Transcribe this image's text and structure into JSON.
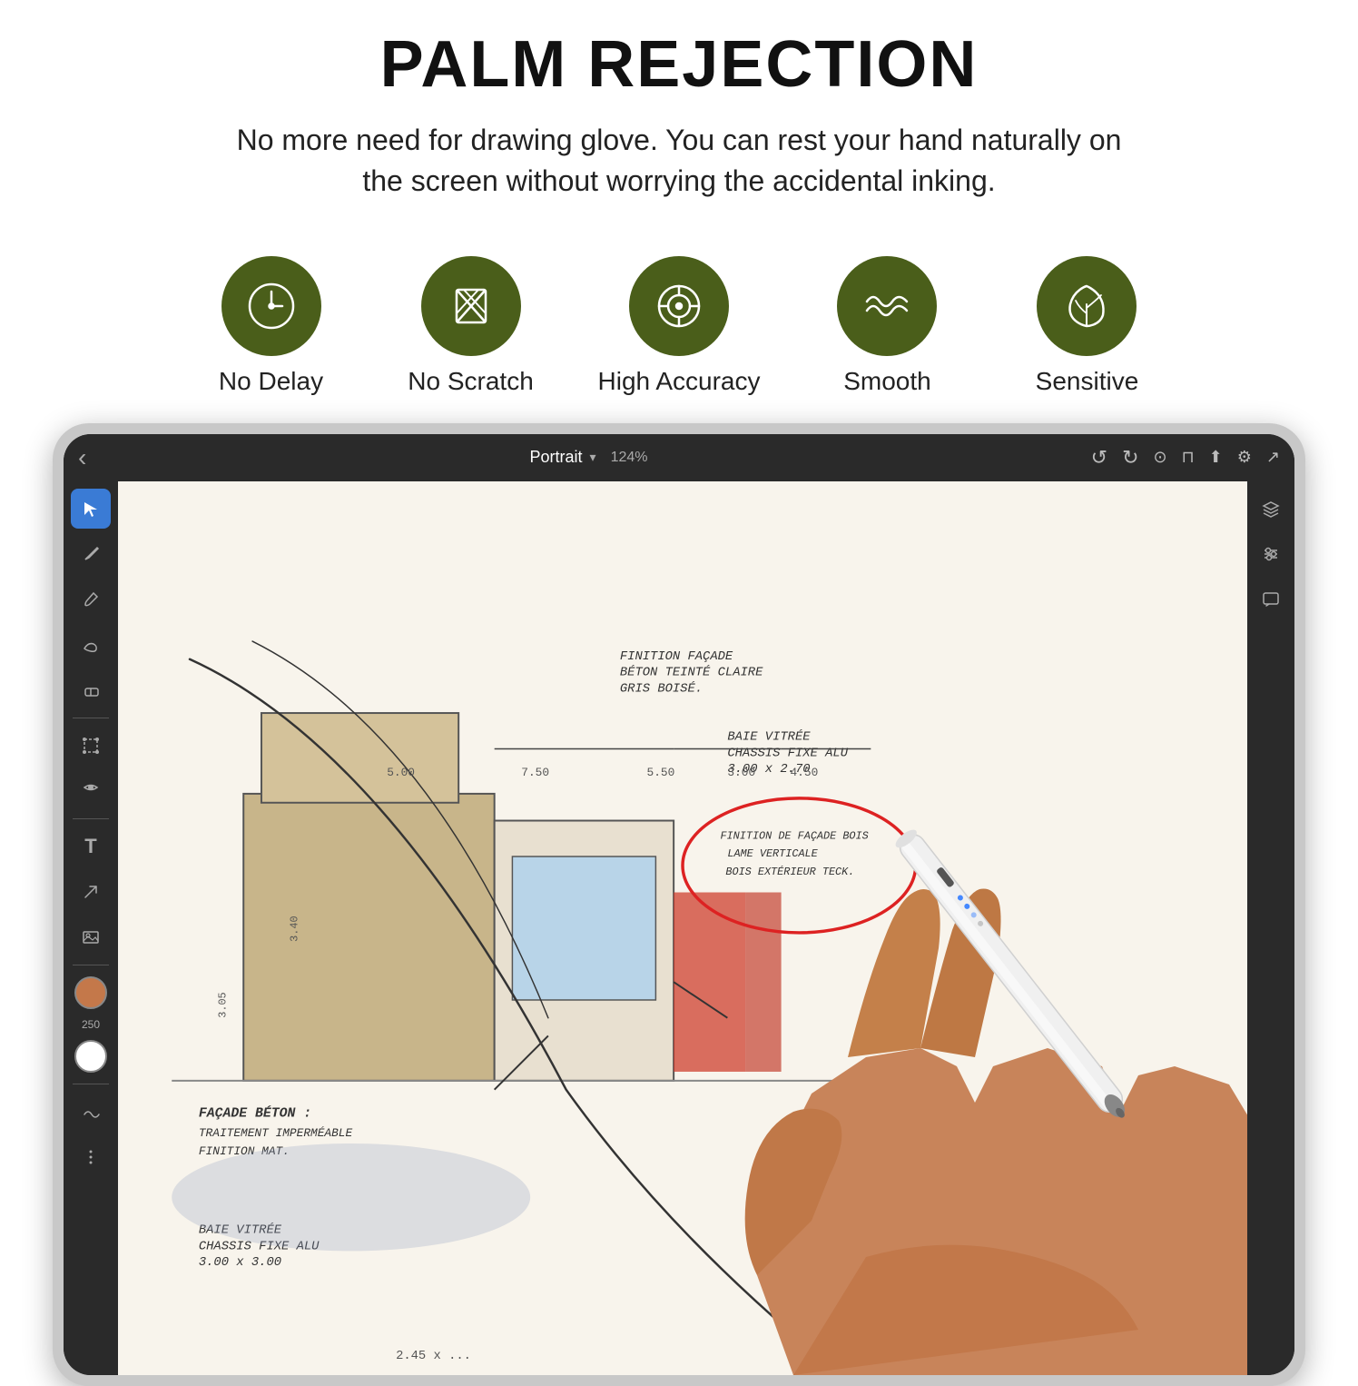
{
  "header": {
    "main_title": "PALM REJECTION",
    "subtitle_line1": "No more need for drawing glove. You can rest your hand naturally on",
    "subtitle_line2": "the screen without worrying the accidental inking."
  },
  "features": [
    {
      "id": "no-delay",
      "label": "No  Delay",
      "icon": "clock-icon"
    },
    {
      "id": "no-scratch",
      "label": "No Scratch",
      "icon": "no-scratch-icon"
    },
    {
      "id": "high-accuracy",
      "label": "High Accuracy",
      "icon": "crosshair-icon"
    },
    {
      "id": "smooth",
      "label": "Smooth",
      "icon": "wave-icon"
    },
    {
      "id": "sensitive",
      "label": "Sensitive",
      "icon": "leaf-icon"
    }
  ],
  "app": {
    "topbar": {
      "back_label": "‹",
      "title": "Portrait",
      "zoom": "124%",
      "undo_icon": "undo-icon",
      "redo_icon": "redo-icon",
      "help_icon": "help-icon",
      "mic_icon": "mic-icon",
      "share_icon": "share-icon",
      "settings_icon": "settings-icon",
      "cursor_icon": "cursor-icon"
    },
    "canvas": {
      "annotations": [
        "FINITION FAÇADE",
        "BÉTON TEINTÉ CLAIRE",
        "GRIS BOISÉ.",
        "BAIE VITRÉE",
        "CHASSIS FIXE ALU",
        "3.00 x 2.70",
        "FINITION DE FAÇADE BOIS",
        "LAME VERTICALE",
        "BOIS EXTÉRIEUR TECK.",
        "FAÇADE BÉTON :",
        "TRAITEMENT IMPERMÉABLE",
        "FINITION MAT.",
        "BAIE VITRÉE",
        "CHASSIS FIXE ALU",
        "3.00 x 3.00"
      ]
    }
  },
  "colors": {
    "dark_olive": "#4a5e1a",
    "background": "#ffffff",
    "app_dark": "#2a2a2a",
    "canvas_bg": "#f8f4ec",
    "accent_blue": "#3a7bd5"
  }
}
